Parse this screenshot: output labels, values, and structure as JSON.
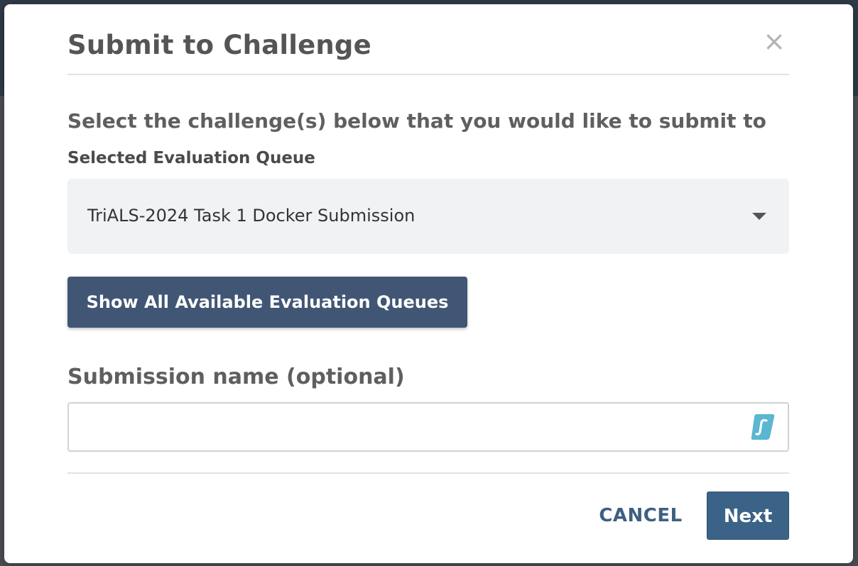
{
  "modal": {
    "title": "Submit to Challenge",
    "close_icon": "close-icon",
    "close_glyph": "×",
    "instructions": "Select the challenge(s) below that you would like to submit to",
    "queue_label": "Selected Evaluation Queue",
    "selected_queue": "TriALS-2024 Task 1 Docker Submission",
    "show_all_button": "Show All Available Evaluation Queues",
    "submission_name_label": "Submission name (optional)",
    "submission_name_value": "",
    "cancel_button": "CANCEL",
    "next_button": "Next"
  },
  "colors": {
    "primary_button": "#415674",
    "next_button": "#3b6388",
    "link": "#3e5f82",
    "extension_icon": "#5bb6d0"
  }
}
